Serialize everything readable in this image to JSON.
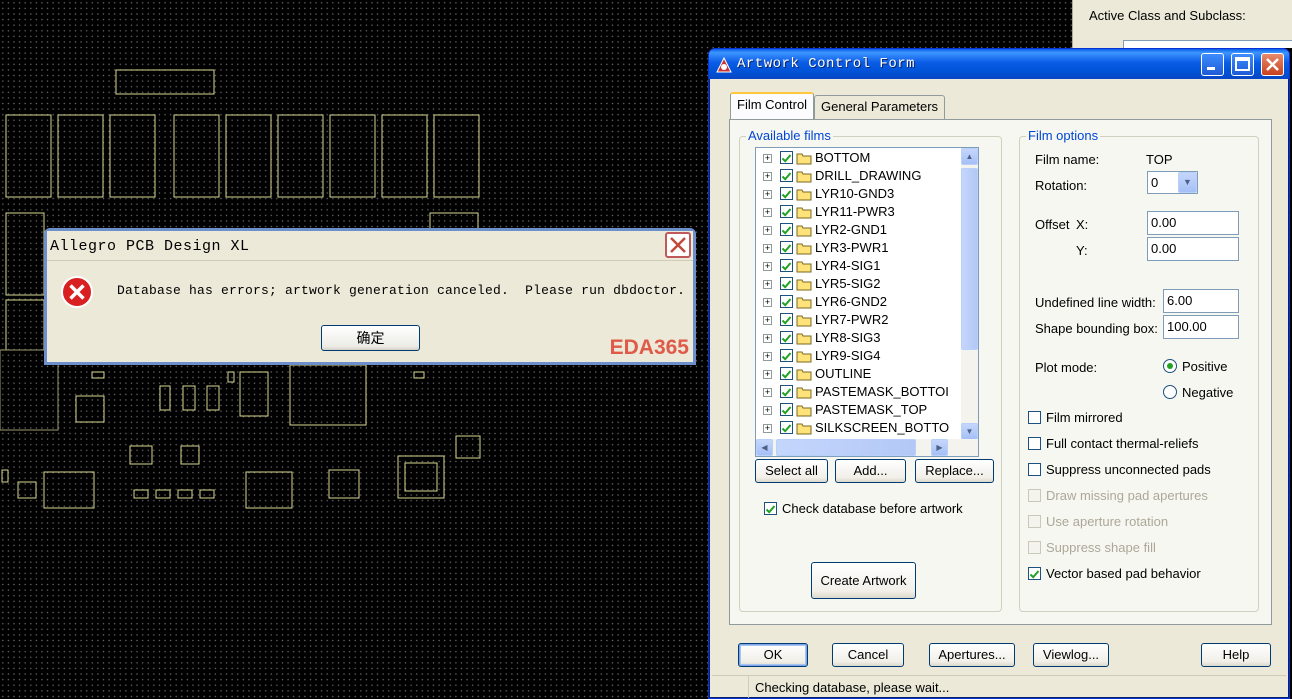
{
  "options_panel": {
    "active_class_label": "Active Class and Subclass:"
  },
  "message_dialog": {
    "title": "Allegro PCB Design XL",
    "message": "Database has errors; artwork generation canceled.  Please run dbdoctor.",
    "ok_label": "确定",
    "watermark": "EDA365",
    "icon": "error-icon"
  },
  "artwork_form": {
    "title": "Artwork Control Form",
    "tabs": [
      "Film Control",
      "General Parameters"
    ],
    "available_films": {
      "label": "Available films",
      "items": [
        "BOTTOM",
        "DRILL_DRAWING",
        "LYR10-GND3",
        "LYR11-PWR3",
        "LYR2-GND1",
        "LYR3-PWR1",
        "LYR4-SIG1",
        "LYR5-SIG2",
        "LYR6-GND2",
        "LYR7-PWR2",
        "LYR8-SIG3",
        "LYR9-SIG4",
        "OUTLINE",
        "PASTEMASK_BOTTOI",
        "PASTEMASK_TOP",
        "SILKSCREEN_BOTTO"
      ],
      "checked": true
    },
    "list_buttons": {
      "select_all": "Select all",
      "add": "Add...",
      "replace": "Replace..."
    },
    "check_database": {
      "label": "Check database before artwork",
      "checked": true
    },
    "create_artwork": "Create Artwork",
    "film_options": {
      "label": "Film options",
      "film_name_label": "Film name:",
      "film_name_value": "TOP",
      "rotation_label": "Rotation:",
      "rotation_value": "0",
      "offset_label": "Offset",
      "x_label": "X:",
      "x_value": "0.00",
      "y_label": "Y:",
      "y_value": "0.00",
      "undefined_line_width_label": "Undefined line width:",
      "undefined_line_width_value": "6.00",
      "shape_bounding_box_label": "Shape bounding box:",
      "shape_bounding_box_value": "100.00",
      "plot_mode_label": "Plot mode:",
      "positive_label": "Positive",
      "negative_label": "Negative",
      "plot_mode_selected": "Positive",
      "checkboxes": [
        {
          "label": "Film mirrored",
          "checked": false,
          "enabled": true
        },
        {
          "label": "Full contact thermal-reliefs",
          "checked": false,
          "enabled": true
        },
        {
          "label": "Suppress unconnected pads",
          "checked": false,
          "enabled": true
        },
        {
          "label": "Draw missing pad apertures",
          "checked": false,
          "enabled": false
        },
        {
          "label": "Use aperture rotation",
          "checked": false,
          "enabled": false
        },
        {
          "label": "Suppress shape fill",
          "checked": false,
          "enabled": false
        },
        {
          "label": "Vector based pad behavior",
          "checked": true,
          "enabled": true
        }
      ]
    },
    "bottom_buttons": {
      "ok": "OK",
      "cancel": "Cancel",
      "apertures": "Apertures...",
      "viewlog": "Viewlog...",
      "help": "Help"
    },
    "status": "Checking database, please wait..."
  },
  "colors": {
    "title_blue": "#0053d6",
    "pcb_outline": "#d8d890",
    "watermark": "#e05a4a",
    "check_green": "#21a121"
  }
}
